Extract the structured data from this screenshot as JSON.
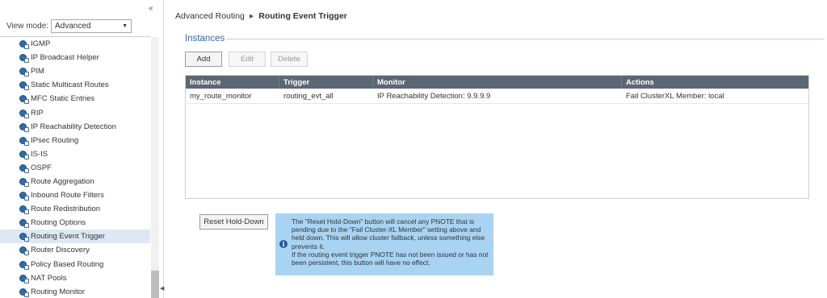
{
  "sidebar": {
    "view_mode_label": "View mode:",
    "view_mode_value": "Advanced",
    "items": [
      {
        "label": "IGMP",
        "active": false
      },
      {
        "label": "IP Broadcast Helper",
        "active": false
      },
      {
        "label": "PIM",
        "active": false
      },
      {
        "label": "Static Multicast Routes",
        "active": false
      },
      {
        "label": "MFC Static Entries",
        "active": false
      },
      {
        "label": "RIP",
        "active": false
      },
      {
        "label": "IP Reachability Detection",
        "active": false
      },
      {
        "label": "IPsec Routing",
        "active": false
      },
      {
        "label": "IS-IS",
        "active": false
      },
      {
        "label": "OSPF",
        "active": false
      },
      {
        "label": "Route Aggregation",
        "active": false
      },
      {
        "label": "Inbound Route Filters",
        "active": false
      },
      {
        "label": "Route Redistribution",
        "active": false
      },
      {
        "label": "Routing Options",
        "active": false
      },
      {
        "label": "Routing Event Trigger",
        "active": true
      },
      {
        "label": "Router Discovery",
        "active": false
      },
      {
        "label": "Policy Based Routing",
        "active": false
      },
      {
        "label": "NAT Pools",
        "active": false
      },
      {
        "label": "Routing Monitor",
        "active": false
      }
    ]
  },
  "breadcrumb": {
    "parent": "Advanced Routing",
    "current": "Routing Event Trigger"
  },
  "instances": {
    "title": "Instances",
    "buttons": {
      "add": "Add",
      "edit": "Edit",
      "delete": "Delete"
    },
    "columns": [
      "Instance",
      "Trigger",
      "Monitor",
      "Actions"
    ],
    "rows": [
      [
        "my_route_monitor",
        "routing_evt_all",
        "IP Reachability Detection: 9.9.9.9",
        "Fail ClusterXL Member: local"
      ]
    ]
  },
  "reset": {
    "button_label": "Reset Hold-Down",
    "hint_line1": "The \"Reset Hold-Down\" button will cancel any PNOTE that is pending due to the \"Fail Cluster-XL Member\" setting above and held down. This will allow cluster failback, unless something else prevents it.",
    "hint_line2": "If the routing event trigger PNOTE has not been issued or has not been persistent, this button will have no effect."
  },
  "colors": {
    "table_header": "#5b6774",
    "accent": "#2a6ab0",
    "hint_bg": "#a9d3f2",
    "active_nav": "#dde8f5"
  },
  "icons": {
    "nav_item": "routing-module-icon",
    "info": "info-icon",
    "collapse": "double-chevron-left-icon",
    "dropdown": "chevron-down-icon"
  }
}
